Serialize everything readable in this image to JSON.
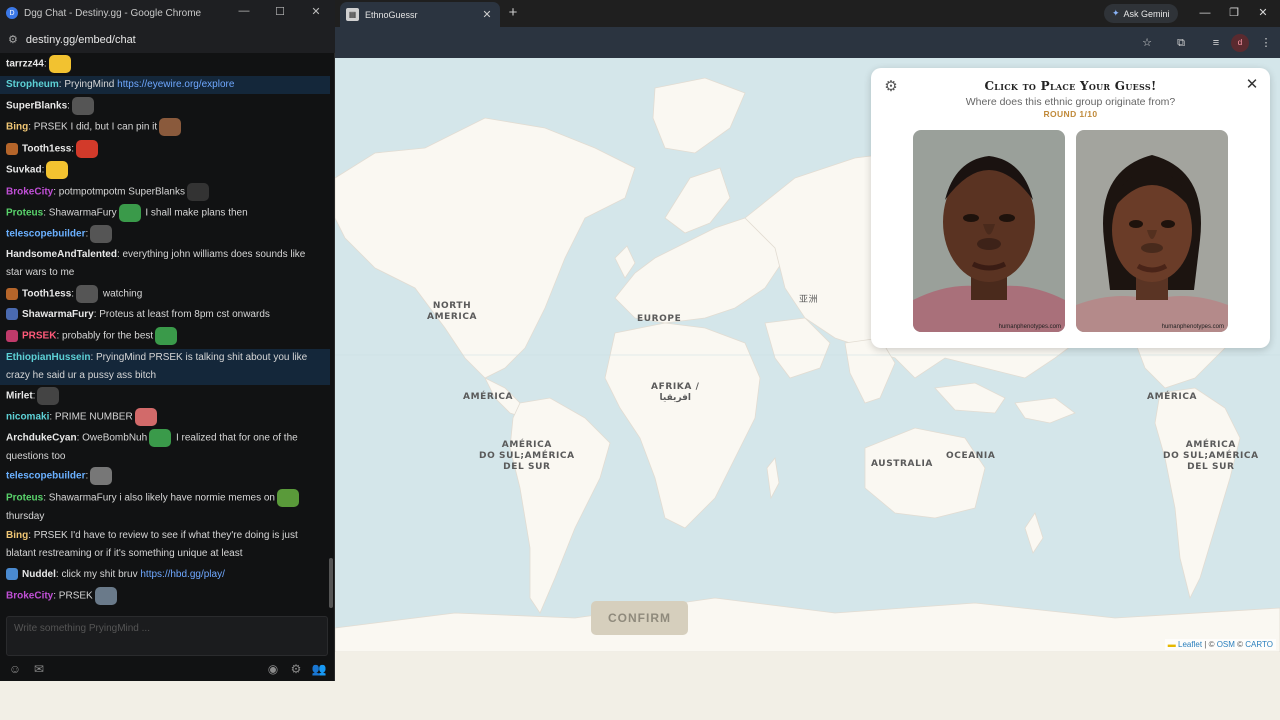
{
  "browser": {
    "tab_title": "EthnoGuessr",
    "tab_favicon": "ethnoguessr-favicon",
    "new_tab_glyph": "+",
    "ask_gemini_label": "Ask Gemini",
    "profile_initial": "d"
  },
  "map": {
    "labels": {
      "north_america": "NORTH\nAMERICA",
      "america_left": "AMÉRICA",
      "south_america_left": "AMÉRICA\nDO SUL;AMÉRICA\nDEL SUR",
      "europe": "EUROPE",
      "africa": "AFRIKA /\nافريقيا",
      "asia": "亚洲",
      "australia": "AUSTRALIA",
      "oceania": "OCEANIA",
      "america_right": "AMÉRICA",
      "south_america_right": "AMÉRICA\nDO SUL;AMÉRICA\nDEL SUR"
    },
    "attribution": {
      "leaflet": "Leaflet",
      "sep": " | © ",
      "osm": "OSM",
      "mid": " © ",
      "carto": "CARTO"
    },
    "colors": {
      "water": "#d4e6ea",
      "land": "#faf8f2",
      "border": "#dcd6cf"
    }
  },
  "confirm_button": "CONFIRM",
  "guess_panel": {
    "title": "Click to Place Your Guess!",
    "subtitle": "Where does this ethnic group originate from?",
    "round": "ROUND 1/10",
    "face_credit": "humanphenotypes.com",
    "accent": "#c08a3a"
  },
  "chat": {
    "window_title": "Dgg Chat - Destiny.gg - Google Chrome",
    "url": "destiny.gg/embed/chat",
    "input_placeholder": "Write something PryingMind ...",
    "messages": [
      {
        "user": "tarrzz44",
        "text": ":",
        "color": "#e8e8e8"
      },
      {
        "user": "Stropheum",
        "text": ": PryingMind ",
        "link": "https://eyewire.org/explore",
        "color": "#5dd1d6"
      },
      {
        "user": "SuperBlanks",
        "text": ":",
        "color": "#e8e8e8"
      },
      {
        "user": "Bing",
        "text": ": PRSEK I did, but I can pin it",
        "color": "#f0c674"
      },
      {
        "user": "Tooth1ess",
        "text": ":",
        "color": "#e8e8e8"
      },
      {
        "user": "Suvkad",
        "text": ":",
        "color": "#e8e8e8"
      },
      {
        "user": "BrokeCity",
        "text": ": potmpotmpotm SuperBlanks",
        "color": "#c04fd6"
      },
      {
        "user": "Proteus",
        "text": ": ShawarmaFury",
        "text2": " I shall make plans then",
        "color": "#59d36b"
      },
      {
        "user": "telescopebuilder",
        "text": ":",
        "color": "#6ab0ff"
      },
      {
        "user": "HandsomeAndTalented",
        "text": ": everything john williams does sounds like",
        "line2": "star wars to me",
        "color": "#e8e8e8"
      },
      {
        "user": "Tooth1ess",
        "text": ":",
        "text2": " watching",
        "color": "#e8e8e8"
      },
      {
        "user": "ShawarmaFury",
        "text": ": Proteus at least from 8pm cst onwards",
        "color": "#e8e8e8"
      },
      {
        "user": "PRSEK",
        "text": ": probably for the best",
        "color": "#ff5a7a"
      },
      {
        "user": "EthiopianHussein",
        "text": ": PryingMind PRSEK is talking shit about you like",
        "line2": "crazy he said ur a pussy ass bitch",
        "color": "#5dd1d6"
      },
      {
        "user": "Mirlet",
        "text": ":",
        "color": "#e8e8e8"
      },
      {
        "user": "nicomaki",
        "text": ": PRIME NUMBER",
        "color": "#5dd1d6"
      },
      {
        "user": "ArchdukeCyan",
        "text": ": OweBombNuh",
        "text2": " I realized that for one of the",
        "line2": "questions too",
        "color": "#e8e8e8"
      },
      {
        "user": "telescopebuilder",
        "text": ":",
        "color": "#6ab0ff"
      },
      {
        "user": "Proteus",
        "text": ": ShawarmaFury i also likely have normie memes on",
        "line2": "thursday",
        "color": "#59d36b"
      },
      {
        "user": "Bing",
        "text": ": PRSEK I'd have to review to see if what they're doing is just",
        "line2": "blatant restreaming or if it's something unique at least",
        "color": "#f0c674"
      },
      {
        "user": "Nuddel",
        "text": ": click my shit bruv ",
        "link": "https://hbd.gg/play/",
        "color": "#e8e8e8"
      },
      {
        "user": "BrokeCity",
        "text": ": PRSEK",
        "color": "#c04fd6"
      }
    ]
  }
}
